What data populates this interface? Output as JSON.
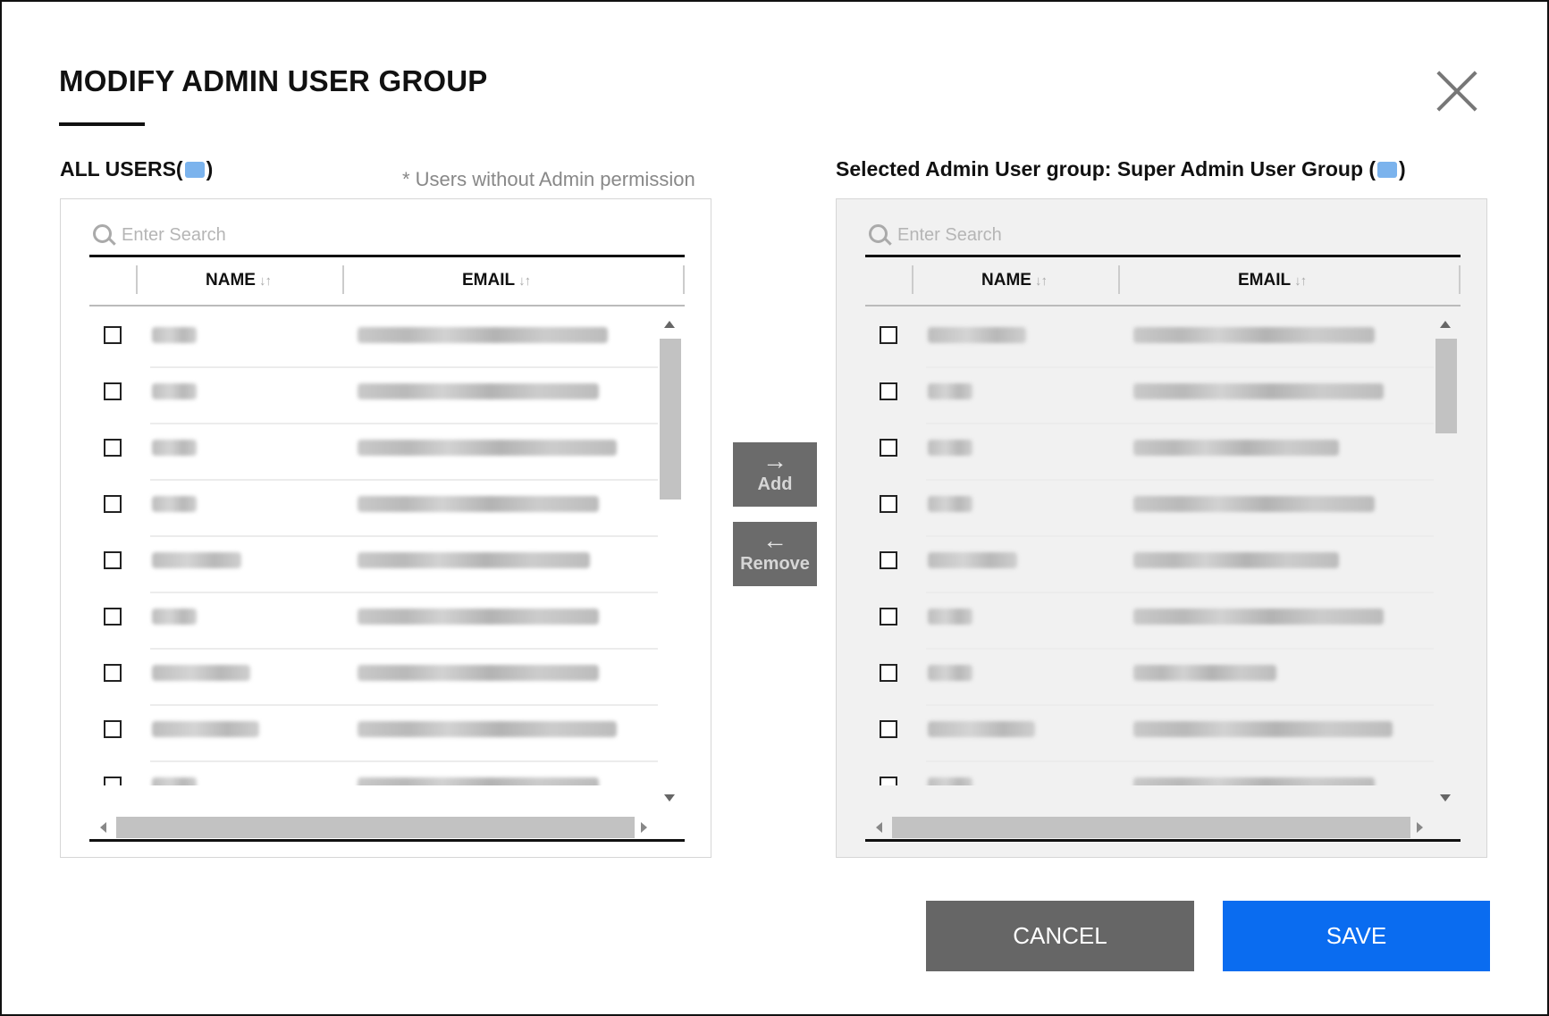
{
  "dialog": {
    "title": "MODIFY ADMIN USER GROUP",
    "cancel_label": "CANCEL",
    "save_label": "SAVE",
    "colors": {
      "primary": "#0a6cf0",
      "cancel": "#666666",
      "move_button": "#6b6b6b"
    }
  },
  "all_users": {
    "label_prefix": "ALL USERS(",
    "label_suffix": ")",
    "note": "* Users without Admin permission",
    "search_placeholder": "Enter Search",
    "columns": {
      "name": "NAME",
      "email": "EMAIL",
      "sort_glyph": "↓↑"
    },
    "vertical_scroll_position": 0.0,
    "rows": [
      {
        "name_w": 50,
        "email_w": 280
      },
      {
        "name_w": 50,
        "email_w": 270
      },
      {
        "name_w": 50,
        "email_w": 290
      },
      {
        "name_w": 50,
        "email_w": 270
      },
      {
        "name_w": 100,
        "email_w": 260
      },
      {
        "name_w": 50,
        "email_w": 270
      },
      {
        "name_w": 110,
        "email_w": 270
      },
      {
        "name_w": 120,
        "email_w": 290
      },
      {
        "name_w": 50,
        "email_w": 270
      }
    ]
  },
  "move": {
    "add_label": "Add",
    "remove_label": "Remove",
    "add_arrow": "→",
    "remove_arrow": "←"
  },
  "selected_group": {
    "label_prefix": "Selected Admin User group: Super Admin User Group (",
    "label_suffix": ")",
    "search_placeholder": "Enter Search",
    "columns": {
      "name": "NAME",
      "email": "EMAIL",
      "sort_glyph": "↓↑"
    },
    "rows": [
      {
        "name_w": 110,
        "email_w": 270
      },
      {
        "name_w": 50,
        "email_w": 280
      },
      {
        "name_w": 50,
        "email_w": 230
      },
      {
        "name_w": 50,
        "email_w": 270
      },
      {
        "name_w": 100,
        "email_w": 230
      },
      {
        "name_w": 50,
        "email_w": 280
      },
      {
        "name_w": 50,
        "email_w": 160
      },
      {
        "name_w": 120,
        "email_w": 290
      },
      {
        "name_w": 50,
        "email_w": 270
      }
    ]
  }
}
